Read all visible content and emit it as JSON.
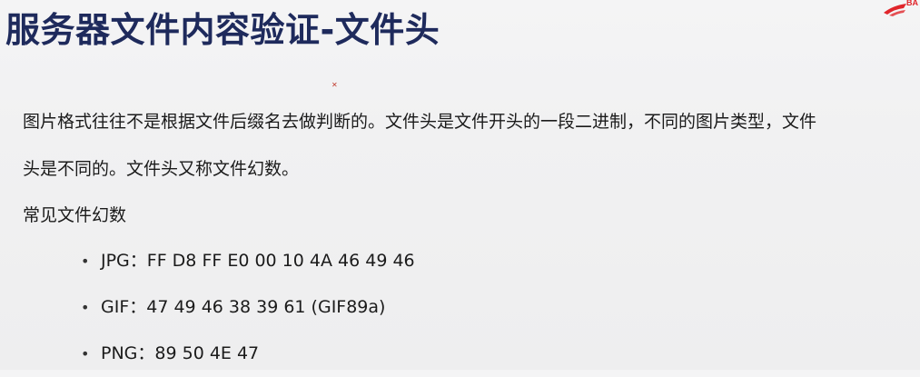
{
  "slide": {
    "title": "服务器文件内容验证-文件头",
    "logo_text": "BA",
    "paragraph_line1": "图片格式往往不是根据文件后缀名去做判断的。文件头是文件开头的一段二进制，不同的图片类型，文件",
    "paragraph_line2": "头是不同的。文件头又称文件幻数。",
    "subheading": "常见文件幻数",
    "bullets": [
      "JPG：FF D8 FF E0 00 10 4A 46 49 46",
      "GIF：47 49 46 38 39 61 (GIF89a)",
      "PNG：89 50 4E 47"
    ]
  },
  "colors": {
    "title": "#1e2a5c",
    "logo_accent": "#e0252b",
    "text": "#1b1b1b"
  },
  "icons": {
    "corner_logo": "brand-swoosh-icon",
    "cursor": "cursor-mark-icon"
  }
}
